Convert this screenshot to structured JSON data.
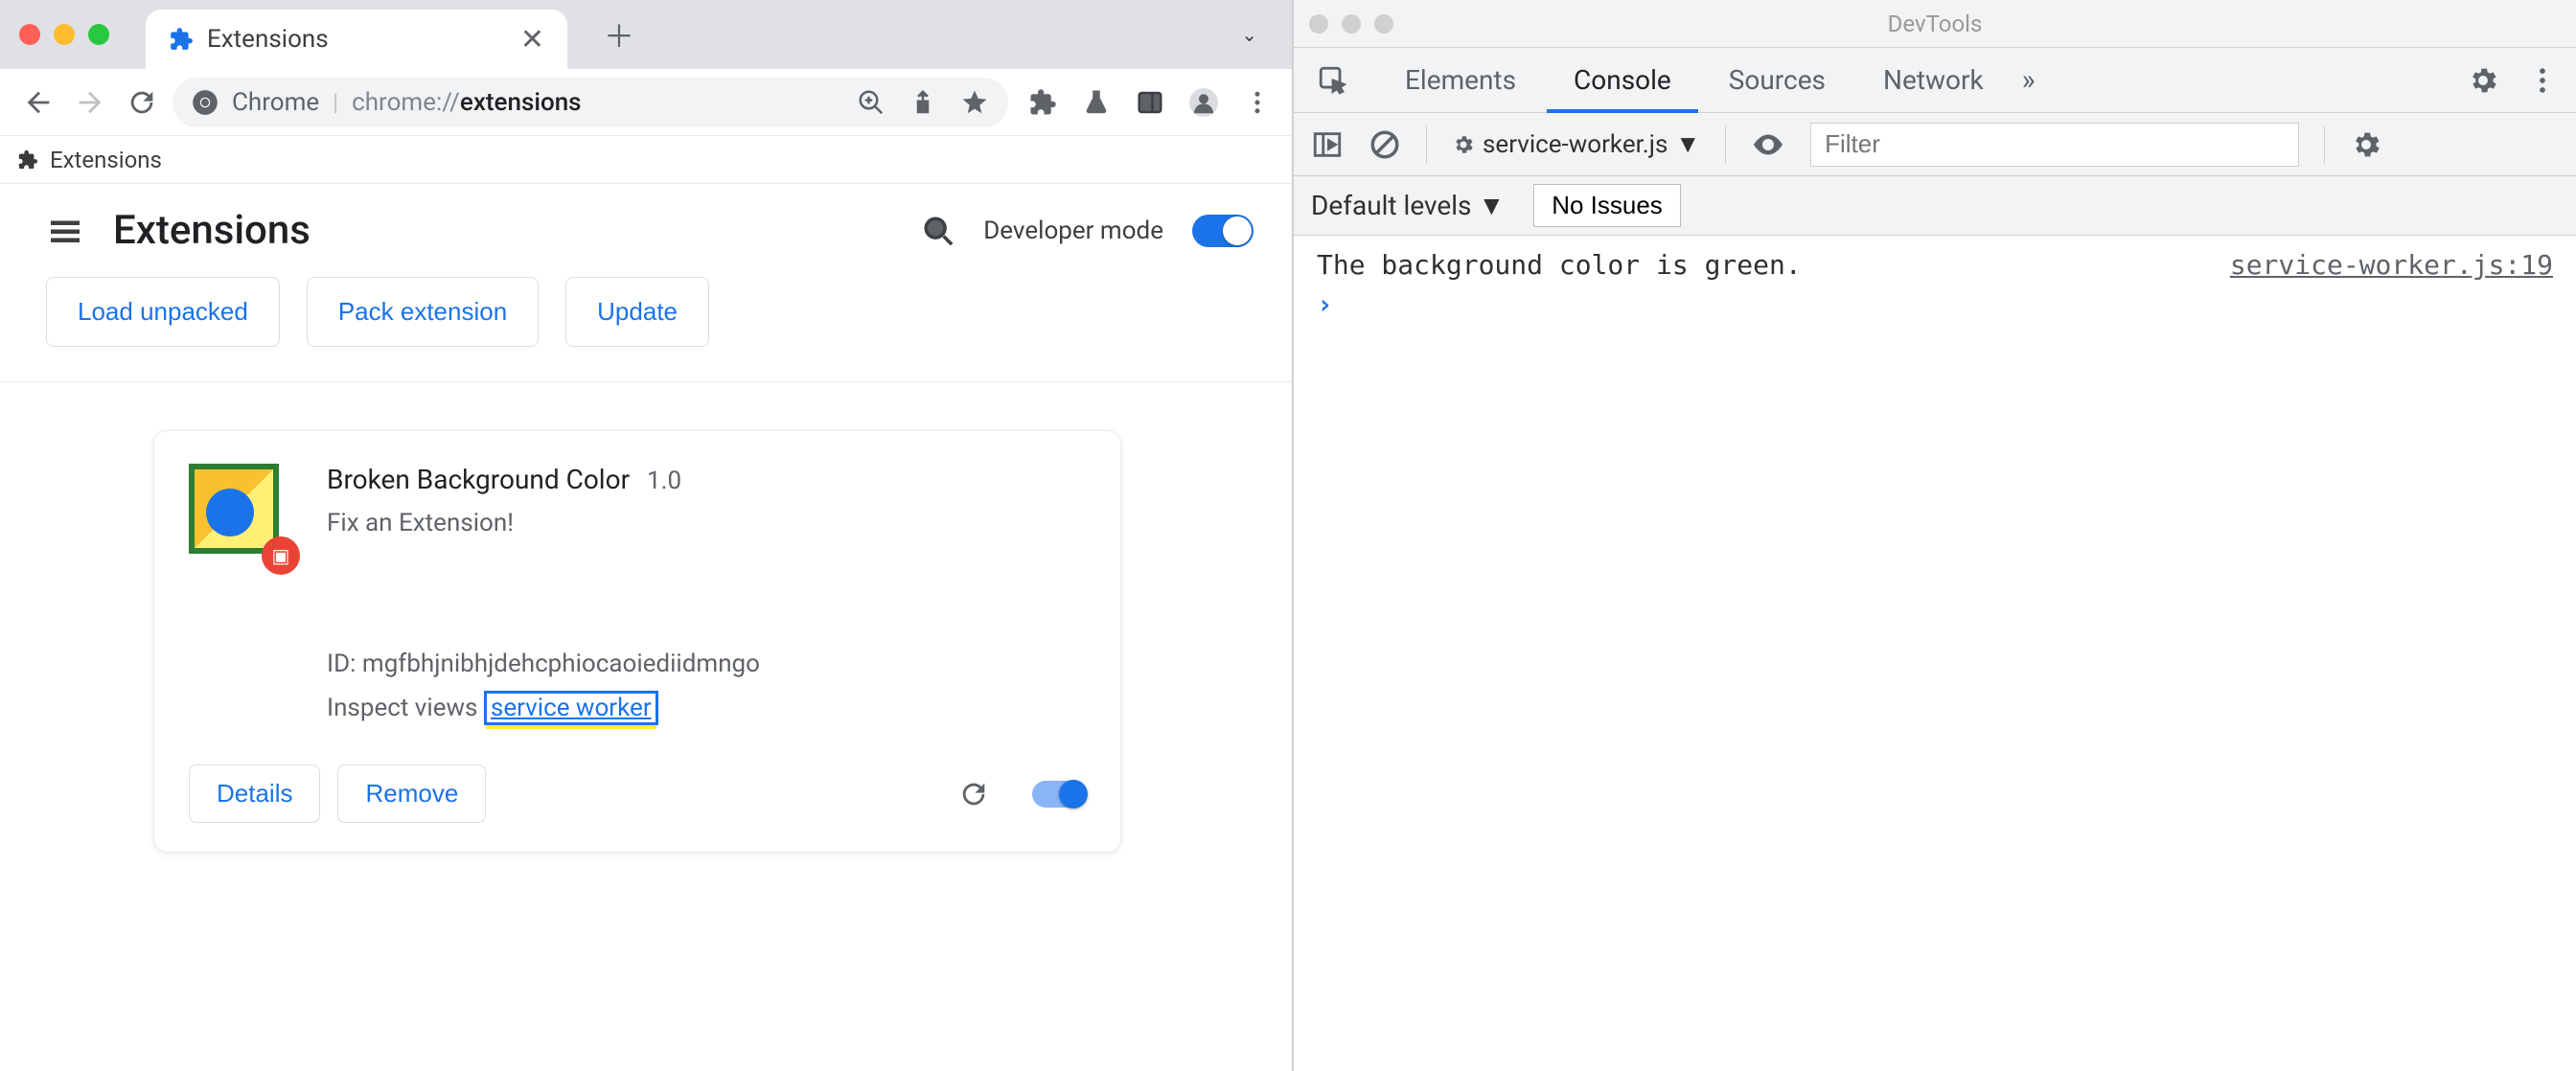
{
  "browser": {
    "tab_title": "Extensions",
    "omnibox": {
      "protocol": "Chrome",
      "url_light": "chrome://",
      "url_dark": "extensions"
    },
    "bookmark_label": "Extensions"
  },
  "page": {
    "title": "Extensions",
    "dev_mode_label": "Developer mode",
    "buttons": {
      "load_unpacked": "Load unpacked",
      "pack_extension": "Pack extension",
      "update": "Update"
    }
  },
  "extension": {
    "name": "Broken Background Color",
    "version": "1.0",
    "description": "Fix an Extension!",
    "id_label": "ID:",
    "id": "mgfbhjnibhjdehcphiocaoiediidmngo",
    "inspect_label": "Inspect views",
    "inspect_link": "service worker",
    "details": "Details",
    "remove": "Remove"
  },
  "devtools": {
    "window_title": "DevTools",
    "tabs": [
      "Elements",
      "Console",
      "Sources",
      "Network"
    ],
    "active_tab": "Console",
    "context": "service-worker.js",
    "filter_placeholder": "Filter",
    "levels": "Default levels",
    "issues": "No Issues",
    "console": {
      "message": "The background color is green.",
      "source": "service-worker.js:19"
    }
  }
}
